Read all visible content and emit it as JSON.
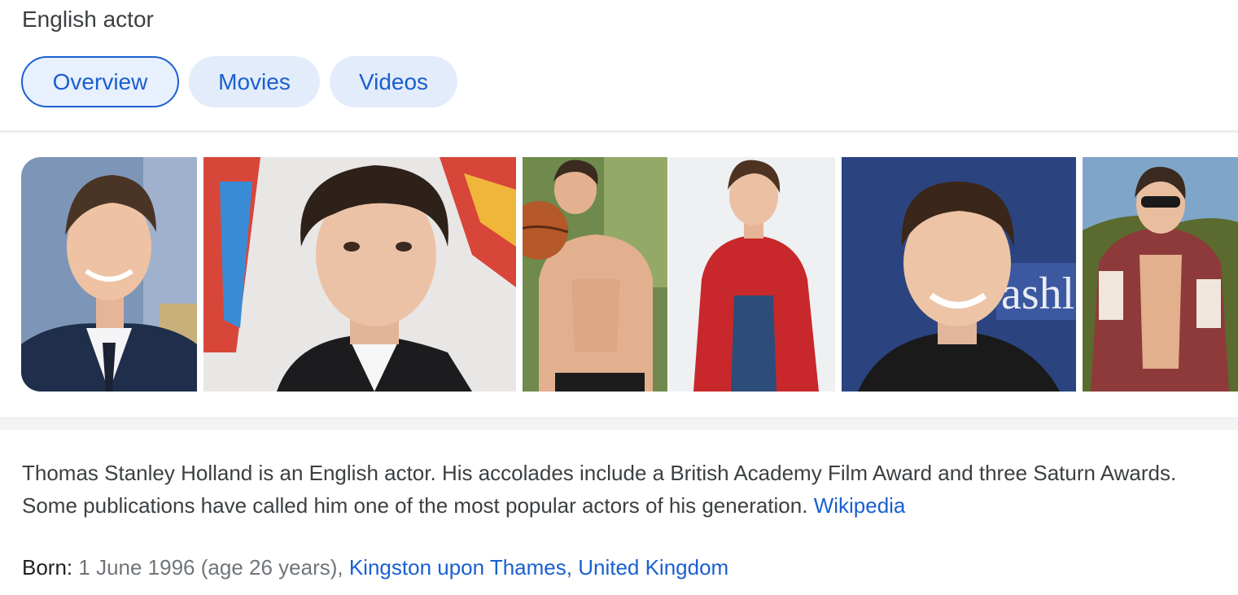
{
  "header": {
    "subtitle": "English actor"
  },
  "tabs": [
    {
      "label": "Overview",
      "active": true
    },
    {
      "label": "Movies",
      "active": false
    },
    {
      "label": "Videos",
      "active": false
    }
  ],
  "gallery": {
    "images": [
      {
        "alt": "Tom Holland portrait in suit"
      },
      {
        "alt": "Tom Holland close-up at premiere"
      },
      {
        "alt": "Tom Holland with basketball"
      },
      {
        "alt": "Tom Holland in Spider-Man suit"
      },
      {
        "alt": "Tom Holland smiling at event"
      },
      {
        "alt": "Tom Holland in sunglasses outdoors"
      }
    ]
  },
  "description": {
    "text": "Thomas Stanley Holland is an English actor. His accolades include a British Academy Film Award and three Saturn Awards. Some publications have called him one of the most popular actors of his generation.",
    "source_link": "Wikipedia"
  },
  "born": {
    "label": "Born:",
    "date": "1 June 1996 (age 26 years),",
    "place_link": "Kingston upon Thames, United Kingdom"
  },
  "colors": {
    "link": "#1a5fd0",
    "chip_bg": "#e3ecfa",
    "muted": "#70757a"
  }
}
